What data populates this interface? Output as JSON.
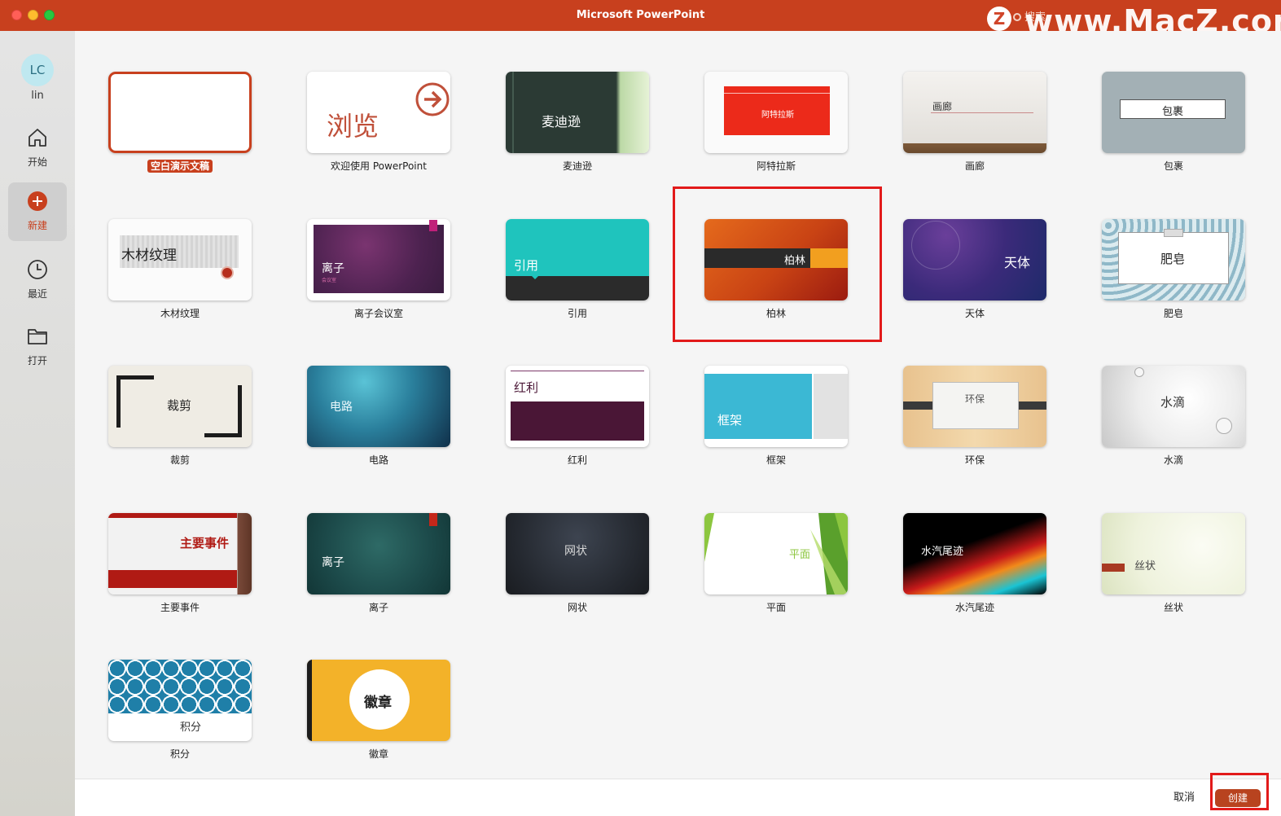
{
  "window": {
    "title": "Microsoft PowerPoint",
    "search_placeholder": "搜索",
    "watermark_badge": "Z",
    "watermark_text": "www.MacZ.com"
  },
  "sidebar": {
    "avatar_initials": "LC",
    "user_name": "lin",
    "items": [
      {
        "label": "开始",
        "icon": "home-icon"
      },
      {
        "label": "新建",
        "icon": "plus-circle-icon",
        "active": true
      },
      {
        "label": "最近",
        "icon": "clock-icon"
      },
      {
        "label": "打开",
        "icon": "folder-icon"
      }
    ]
  },
  "templates": [
    {
      "name": "空白演示文稿",
      "selected": true
    },
    {
      "name": "欢迎使用 PowerPoint",
      "thumb_text": "浏览"
    },
    {
      "name": "麦迪逊",
      "thumb_text": "麦迪逊"
    },
    {
      "name": "阿特拉斯",
      "thumb_text": "阿特拉斯"
    },
    {
      "name": "画廊",
      "thumb_text": "画廊"
    },
    {
      "name": "包裹",
      "thumb_text": "包裹"
    },
    {
      "name": "木材纹理",
      "thumb_text": "木材纹理"
    },
    {
      "name": "离子会议室",
      "thumb_text": "离子",
      "thumb_sub": "会议室"
    },
    {
      "name": "引用",
      "thumb_text": "引用"
    },
    {
      "name": "柏林",
      "thumb_text": "柏林"
    },
    {
      "name": "天体",
      "thumb_text": "天体"
    },
    {
      "name": "肥皂",
      "thumb_text": "肥皂"
    },
    {
      "name": "裁剪",
      "thumb_text": "裁剪"
    },
    {
      "name": "电路",
      "thumb_text": "电路"
    },
    {
      "name": "红利",
      "thumb_text": "红利"
    },
    {
      "name": "框架",
      "thumb_text": "框架"
    },
    {
      "name": "环保",
      "thumb_text": "环保"
    },
    {
      "name": "水滴",
      "thumb_text": "水滴"
    },
    {
      "name": "主要事件",
      "thumb_text": "主要事件"
    },
    {
      "name": "离子",
      "thumb_text": "离子"
    },
    {
      "name": "网状",
      "thumb_text": "网状"
    },
    {
      "name": "平面",
      "thumb_text": "平面"
    },
    {
      "name": "水汽尾迹",
      "thumb_text": "水汽尾迹"
    },
    {
      "name": "丝状",
      "thumb_text": "丝状"
    },
    {
      "name": "积分",
      "thumb_text": "积分"
    },
    {
      "name": "徽章",
      "thumb_text": "徽章"
    }
  ],
  "footer": {
    "cancel_label": "取消",
    "create_label": "创建"
  },
  "colors": {
    "accent": "#c8401e",
    "highlight_box": "#e21a1a"
  }
}
